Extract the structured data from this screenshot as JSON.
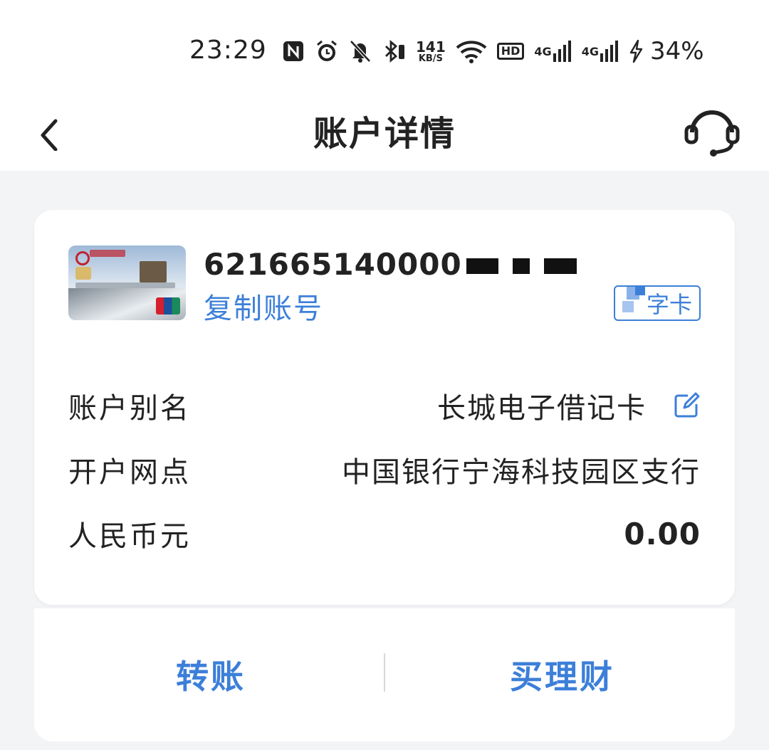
{
  "status_bar": {
    "time": "23:29",
    "net_speed_value": "141",
    "net_speed_unit": "KB/S",
    "hd_label": "HD",
    "signal_1": "4G",
    "signal_2": "4G",
    "battery": "34%",
    "icons": [
      "nfc-icon",
      "alarm-icon",
      "mute-icon",
      "bluetooth-icon",
      "wifi-icon",
      "signal-icon",
      "charging-icon"
    ]
  },
  "header": {
    "title": "账户详情",
    "back_icon": "chevron-left-icon",
    "service_icon": "headset-icon"
  },
  "account": {
    "number_visible": "621665140000",
    "copy_label": "复制账号",
    "card_type": "字卡",
    "rows": [
      {
        "label": "账户别名",
        "value": "长城电子借记卡"
      },
      {
        "label": "开户网点",
        "value": "中国银行宁海科技园区支行"
      },
      {
        "label": "人民币元",
        "value": "0.00"
      }
    ]
  },
  "actions": {
    "transfer": "转账",
    "wealth": "买理财"
  },
  "colors": {
    "accent": "#3c7fd9",
    "background": "#f3f4f6",
    "card": "#ffffff"
  }
}
